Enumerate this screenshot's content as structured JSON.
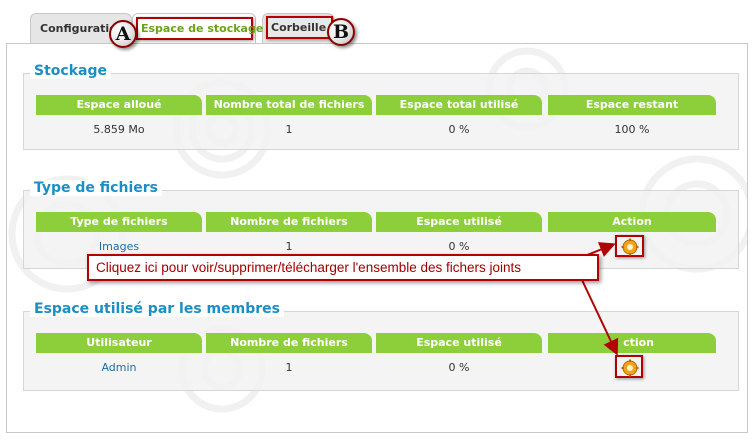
{
  "tabs": {
    "config": "Configuratio",
    "storage": "Espace de stockage",
    "trash": "Corbeille"
  },
  "markers": {
    "a": "A",
    "b": "B"
  },
  "sections": {
    "stock": {
      "title": "Stockage",
      "headers": [
        "Espace alloué",
        "Nombre total de fichiers",
        "Espace total utilisé",
        "Espace restant"
      ],
      "row": [
        "5.859 Mo",
        "1",
        "0 %",
        "100 %"
      ]
    },
    "types": {
      "title": "Type de fichiers",
      "headers": [
        "Type de fichiers",
        "Nombre de fichiers",
        "Espace utilisé",
        "Action"
      ],
      "row": [
        "Images",
        "1",
        "0 %"
      ]
    },
    "members": {
      "title": "Espace utilisé par les membres",
      "headers": [
        "Utilisateur",
        "Nombre de fichiers",
        "Espace utilisé",
        "ction"
      ],
      "row": [
        "Admin",
        "1",
        "0 %"
      ]
    }
  },
  "callout": "Cliquez ici pour voir/supprimer/télécharger l'ensemble des fichers joints",
  "icons": {
    "action": "gear-icon"
  },
  "colors": {
    "header": "#8ccf3a",
    "title": "#1b8fc2",
    "highlight": "#b30000",
    "active_tab": "#6aa31a",
    "link": "#1b6ea8"
  }
}
